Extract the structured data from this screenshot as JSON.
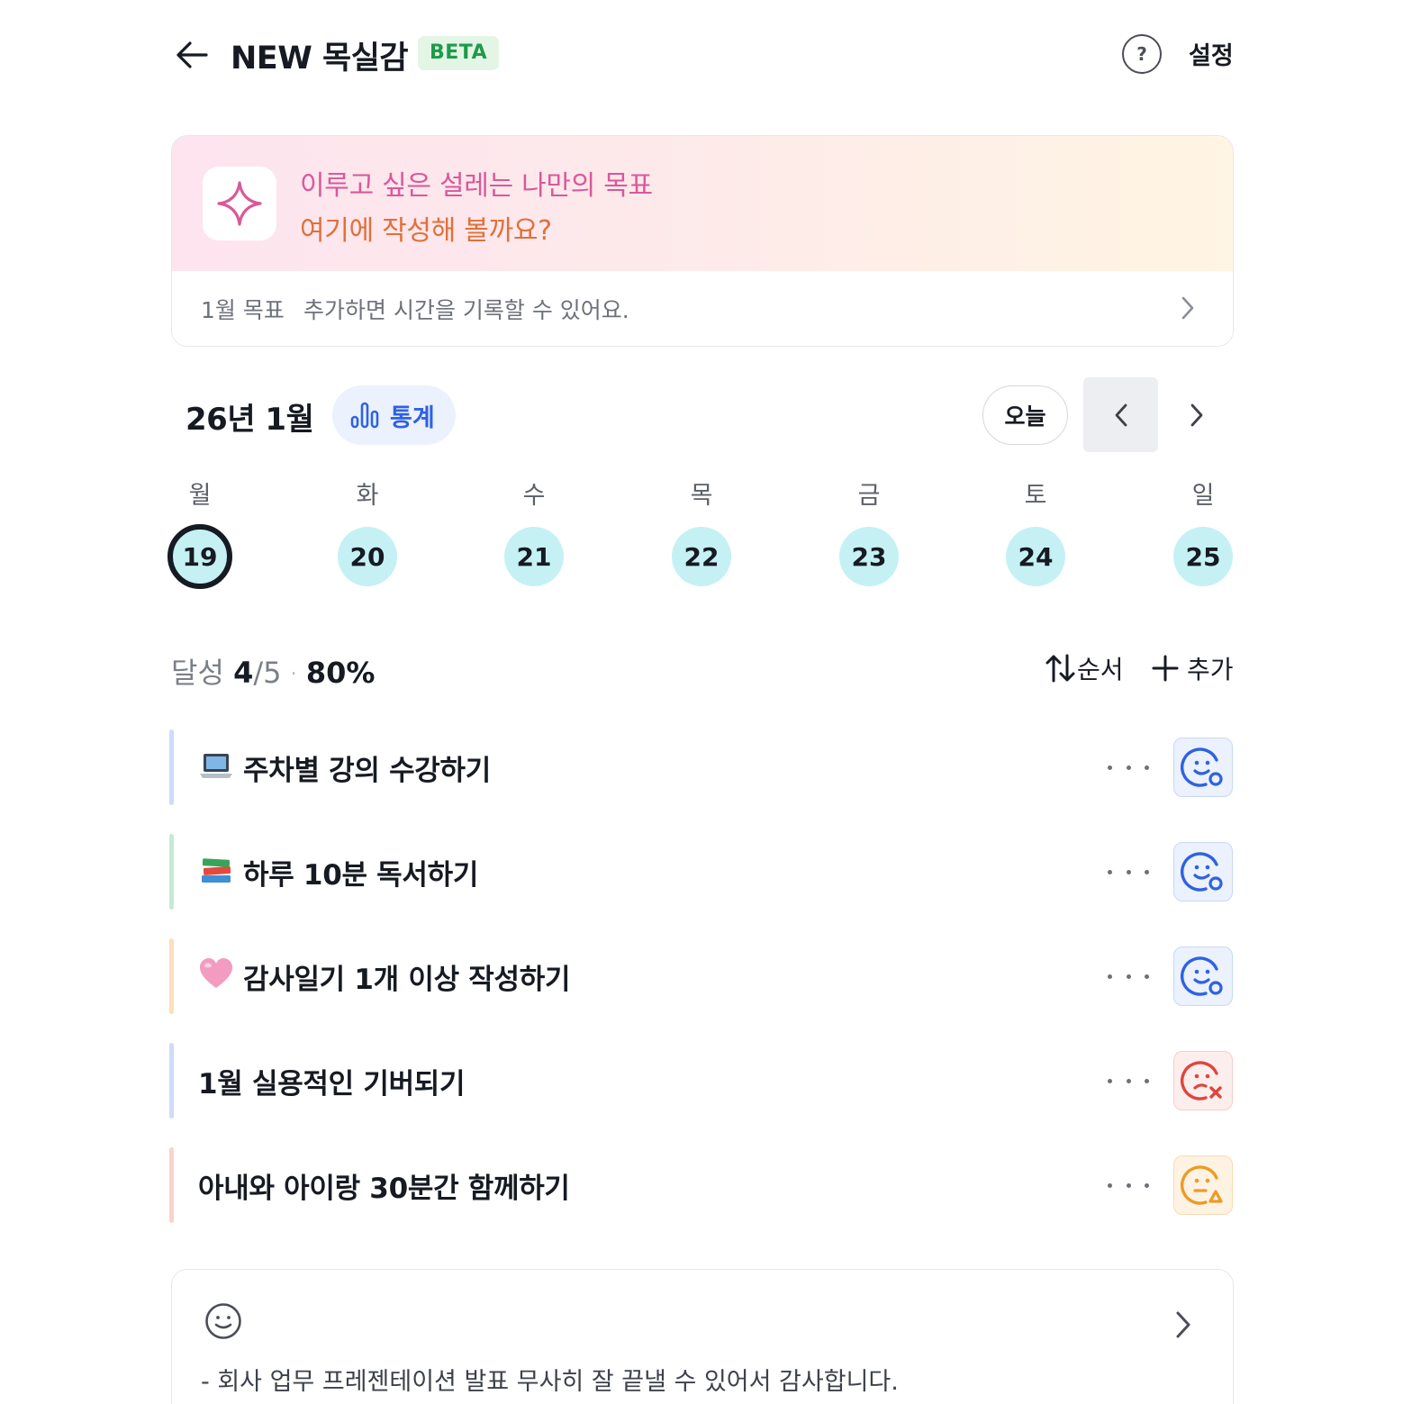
{
  "header": {
    "title": "NEW 목실감",
    "badge": "BETA",
    "help_icon": "question-circle-icon",
    "help_glyph": "?",
    "settings_label": "설정"
  },
  "goal_card": {
    "line1": "이루고 싶은 설레는 나만의 목표",
    "line2": "여기에 작성해 볼까요?",
    "month_label": "1월 목표",
    "hint": "추가하면 시간을 기록할 수 있어요.",
    "colors": {
      "line1": "#d9589a",
      "line2": "#e0703b"
    }
  },
  "calendar": {
    "month_label": "26년 1월",
    "stats_label": "통계",
    "today_label": "오늘",
    "weekdays": [
      "월",
      "화",
      "수",
      "목",
      "금",
      "토",
      "일"
    ],
    "days": [
      "19",
      "20",
      "21",
      "22",
      "23",
      "24",
      "25"
    ],
    "selected_day": "19"
  },
  "summary": {
    "label": "달성",
    "done": "4",
    "total": "/5",
    "separator": "·",
    "percent": "80%",
    "order_label": "순서",
    "add_label": "추가"
  },
  "habits": [
    {
      "emoji": "laptop-icon",
      "title": "주차별 강의 수강하기",
      "bar_color": "#cfdcf8",
      "status": "smile-check",
      "status_color": "#2e62e0"
    },
    {
      "emoji": "books-icon",
      "title": "하루 10분 독서하기",
      "bar_color": "#c2ecd4",
      "status": "smile-check",
      "status_color": "#2e62e0"
    },
    {
      "emoji": "pink-heart-icon",
      "title": "감사일기 1개 이상 작성하기",
      "bar_color": "#fbe0bd",
      "status": "smile-check",
      "status_color": "#2e62e0"
    },
    {
      "emoji": "",
      "title": "1월 실용적인 기버되기",
      "bar_color": "#cfdcf8",
      "status": "sad-x",
      "status_color": "#e0453b"
    },
    {
      "emoji": "",
      "title": "아내와 아이랑 30분간 함께하기",
      "bar_color": "#f8d4ca",
      "status": "neutral-triangle",
      "status_color": "#ee9a25"
    }
  ],
  "diary": {
    "text": "- 회사 업무 프레젠테이션 발표 무사히 잘 끝낼 수 있어서 감사합니다."
  }
}
